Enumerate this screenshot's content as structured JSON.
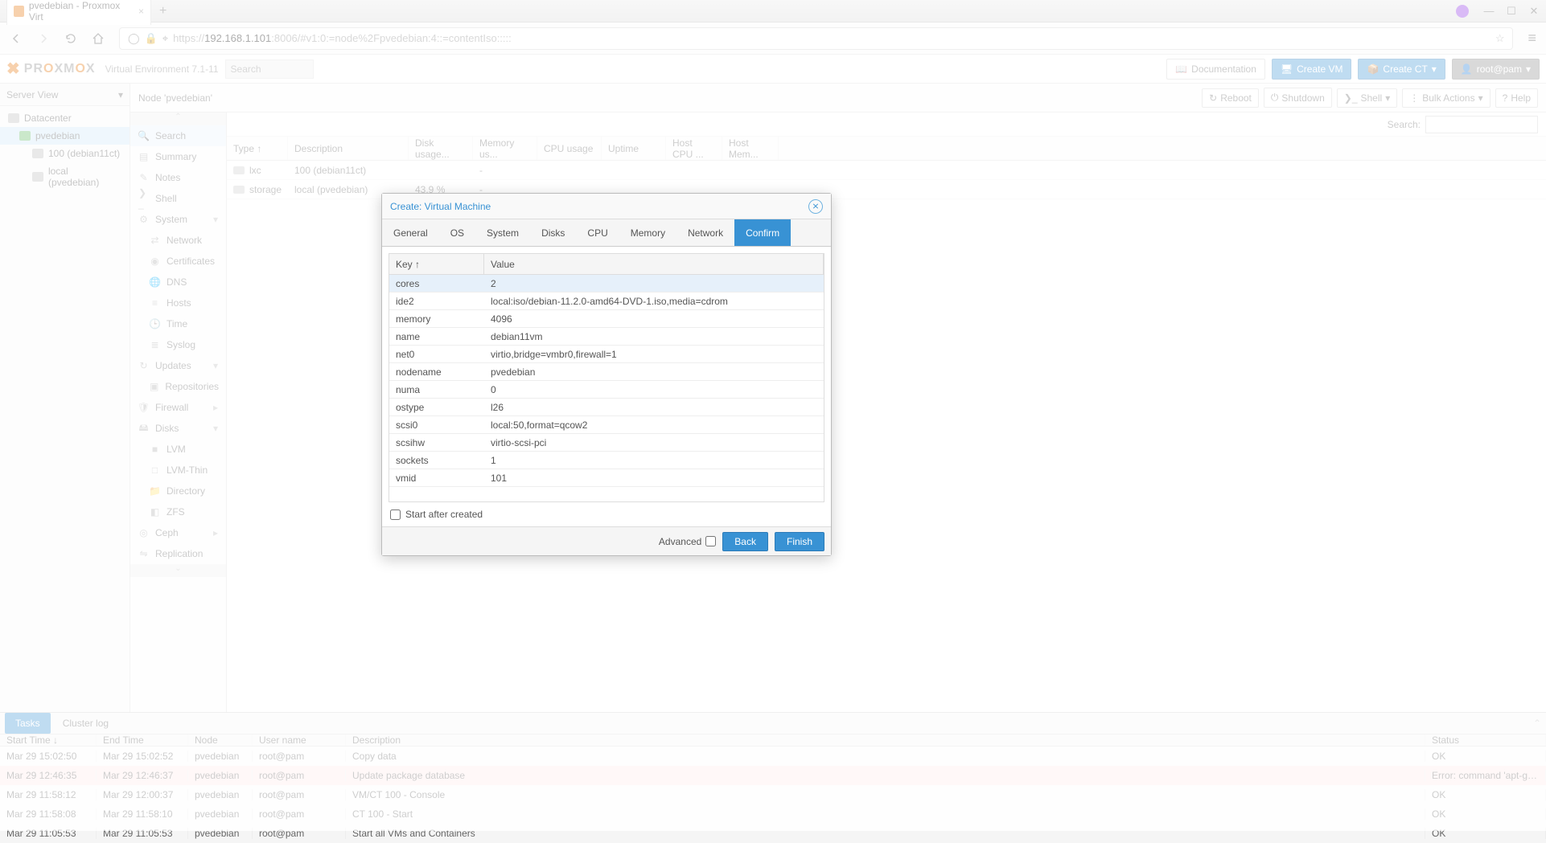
{
  "os": {
    "tab_title": "pvedebian - Proxmox Virt",
    "window_icons": {
      "minimize": "—",
      "maximize": "☐",
      "close": "✕"
    }
  },
  "urlbar": {
    "back": "←",
    "forward": "→",
    "reload": "↻",
    "home": "⌂",
    "proto": "https://",
    "host": "192.168.1.101",
    "rest": ":8006/#v1:0:=node%2Fpvedebian:4::=contentIso:::::",
    "star": "☆",
    "menu": "≡"
  },
  "pve": {
    "logo_text": "PROXMOX",
    "version": "Virtual Environment 7.1-11",
    "search_placeholder": "Search",
    "doc": "Documentation",
    "create_vm": "Create VM",
    "create_ct": "Create CT",
    "user": "root@pam"
  },
  "tree": {
    "title": "Server View",
    "datacenter": "Datacenter",
    "node": "pvedebian",
    "ct": "100 (debian11ct)",
    "storage": "local (pvedebian)"
  },
  "content_head": {
    "title": "Node 'pvedebian'",
    "reboot": "Reboot",
    "shutdown": "Shutdown",
    "shell": "Shell",
    "bulk": "Bulk Actions",
    "help": "Help"
  },
  "side_menu": [
    "Search",
    "Summary",
    "Notes",
    "Shell",
    "System",
    "Network",
    "Certificates",
    "DNS",
    "Hosts",
    "Time",
    "Syslog",
    "Updates",
    "Repositories",
    "Firewall",
    "Disks",
    "LVM",
    "LVM-Thin",
    "Directory",
    "ZFS",
    "Ceph",
    "Replication"
  ],
  "grid": {
    "search_label": "Search:",
    "cols": {
      "type": "Type ↑",
      "desc": "Description",
      "disk": "Disk usage...",
      "mem": "Memory us...",
      "cpu": "CPU usage",
      "up": "Uptime",
      "hcpu": "Host CPU ...",
      "hmem": "Host Mem..."
    },
    "rows": [
      {
        "type_icon": "lxc",
        "type": "lxc",
        "desc": "100 (debian11ct)",
        "disk": "",
        "mem": "-",
        "cpu": "",
        "up": "",
        "hcpu": "",
        "hmem": ""
      },
      {
        "type_icon": "storage",
        "type": "storage",
        "desc": "local (pvedebian)",
        "disk": "43.9 %",
        "mem": "-",
        "cpu": "",
        "up": "",
        "hcpu": "",
        "hmem": ""
      }
    ]
  },
  "tasks": {
    "tabs": {
      "tasks": "Tasks",
      "cluster": "Cluster log"
    },
    "head": {
      "st": "Start Time ↓",
      "et": "End Time",
      "nd": "Node",
      "un": "User name",
      "de": "Description",
      "stat": "Status"
    },
    "rows": [
      {
        "st": "Mar 29 15:02:50",
        "et": "Mar 29 15:02:52",
        "nd": "pvedebian",
        "un": "root@pam",
        "de": "Copy data",
        "stat": "OK",
        "err": false
      },
      {
        "st": "Mar 29 12:46:35",
        "et": "Mar 29 12:46:37",
        "nd": "pvedebian",
        "un": "root@pam",
        "de": "Update package database",
        "stat": "Error: command 'apt-get upd...",
        "err": true
      },
      {
        "st": "Mar 29 11:58:12",
        "et": "Mar 29 12:00:37",
        "nd": "pvedebian",
        "un": "root@pam",
        "de": "VM/CT 100 - Console",
        "stat": "OK",
        "err": false
      },
      {
        "st": "Mar 29 11:58:08",
        "et": "Mar 29 11:58:10",
        "nd": "pvedebian",
        "un": "root@pam",
        "de": "CT 100 - Start",
        "stat": "OK",
        "err": false
      },
      {
        "st": "Mar 29 11:05:53",
        "et": "Mar 29 11:05:53",
        "nd": "pvedebian",
        "un": "root@pam",
        "de": "Start all VMs and Containers",
        "stat": "OK",
        "err": false
      }
    ]
  },
  "modal": {
    "title": "Create: Virtual Machine",
    "tabs": [
      "General",
      "OS",
      "System",
      "Disks",
      "CPU",
      "Memory",
      "Network",
      "Confirm"
    ],
    "active_tab": "Confirm",
    "kv_head": {
      "key": "Key ↑",
      "val": "Value"
    },
    "kv": [
      {
        "k": "cores",
        "v": "2"
      },
      {
        "k": "ide2",
        "v": "local:iso/debian-11.2.0-amd64-DVD-1.iso,media=cdrom"
      },
      {
        "k": "memory",
        "v": "4096"
      },
      {
        "k": "name",
        "v": "debian11vm"
      },
      {
        "k": "net0",
        "v": "virtio,bridge=vmbr0,firewall=1"
      },
      {
        "k": "nodename",
        "v": "pvedebian"
      },
      {
        "k": "numa",
        "v": "0"
      },
      {
        "k": "ostype",
        "v": "l26"
      },
      {
        "k": "scsi0",
        "v": "local:50,format=qcow2"
      },
      {
        "k": "scsihw",
        "v": "virtio-scsi-pci"
      },
      {
        "k": "sockets",
        "v": "1"
      },
      {
        "k": "vmid",
        "v": "101"
      }
    ],
    "start_after": "Start after created",
    "advanced": "Advanced",
    "back": "Back",
    "finish": "Finish",
    "close_glyph": "⨯"
  }
}
